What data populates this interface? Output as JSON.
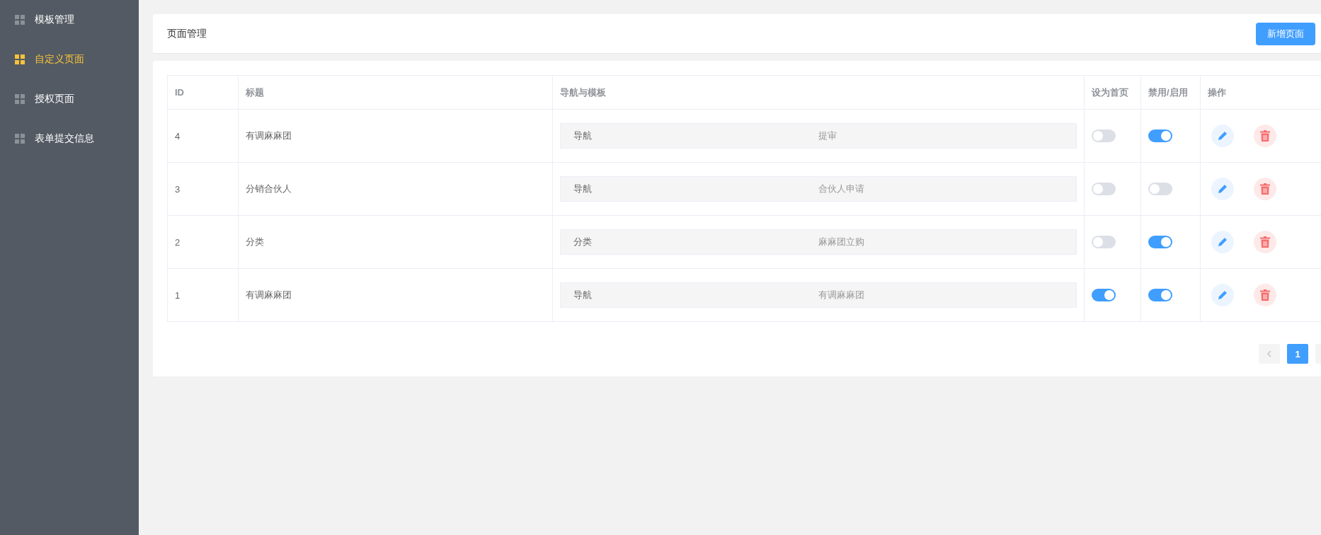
{
  "sidebar": {
    "items": [
      {
        "label": "模板管理",
        "selected": false
      },
      {
        "label": "自定义页面",
        "selected": true
      },
      {
        "label": "授权页面",
        "selected": false
      },
      {
        "label": "表单提交信息",
        "selected": false
      }
    ]
  },
  "header": {
    "title": "页面管理",
    "button": "新增页面"
  },
  "table": {
    "columns": [
      "ID",
      "标题",
      "导航与模板",
      "设为首页",
      "禁用/启用",
      "操作"
    ],
    "rows": [
      {
        "id": "4",
        "title": "有调麻麻团",
        "nav": "导航",
        "template": "提审",
        "homepage": false,
        "enabled": true
      },
      {
        "id": "3",
        "title": "分销合伙人",
        "nav": "导航",
        "template": "合伙人申请",
        "homepage": false,
        "enabled": false
      },
      {
        "id": "2",
        "title": "分类",
        "nav": "分类",
        "template": "麻麻团立购",
        "homepage": false,
        "enabled": true
      },
      {
        "id": "1",
        "title": "有调麻麻团",
        "nav": "导航",
        "template": "有调麻麻团",
        "homepage": true,
        "enabled": true
      }
    ]
  },
  "pagination": {
    "pages": [
      {
        "label": "1",
        "selected": true
      }
    ]
  }
}
